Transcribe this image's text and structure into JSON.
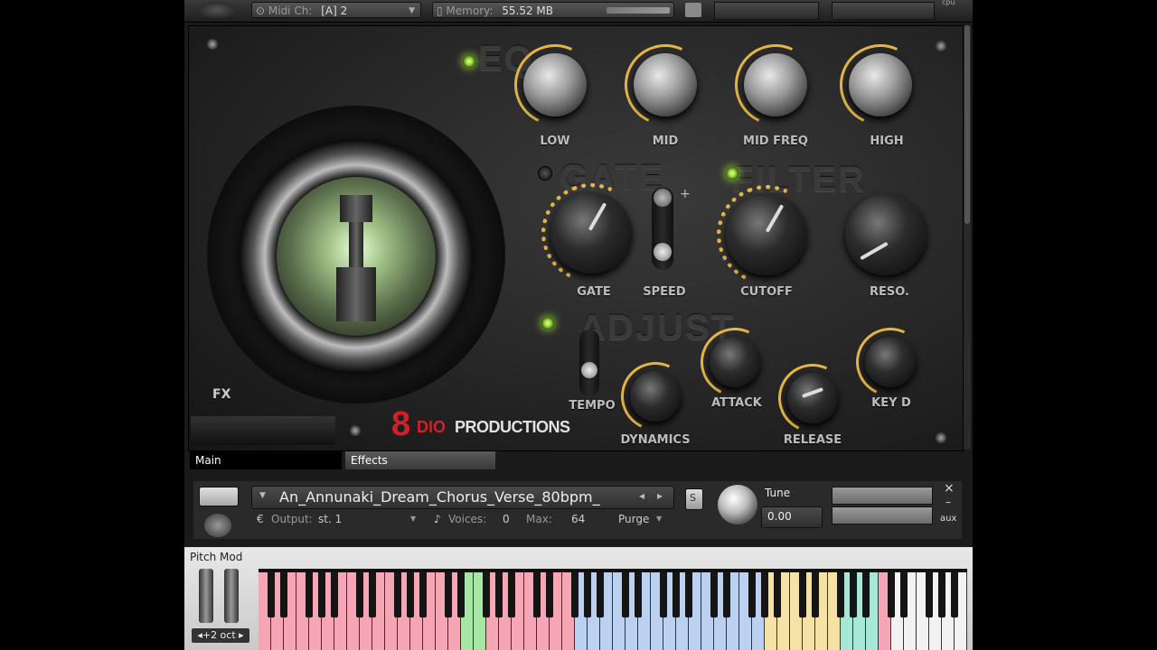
{
  "topbar": {
    "midi_label": "Midi Ch:",
    "midi_value": "[A]  2",
    "memory_label": "Memory:",
    "memory_value": "55.52 MB",
    "cpu_label": "cpu"
  },
  "panel": {
    "section_eq": "EQ",
    "section_gate": "GATE",
    "section_filter": "FILTER",
    "section_adjust": "ADJUST",
    "fx_label": "FX",
    "brand_mark": "8",
    "brand_dio": "DIO",
    "brand_productions": "PRODUCTIONS",
    "knobs": {
      "low": "LOW",
      "mid": "MID",
      "mid_freq": "MID FREQ",
      "high": "HIGH",
      "gate": "GATE",
      "speed": "SPEED",
      "cutoff": "CUTOFF",
      "reso": "RESO.",
      "tempo": "TEMPO",
      "dynamics": "DYNAMICS",
      "attack": "ATTACK",
      "release": "RELEASE",
      "key": "KEY  D"
    },
    "speed_plus": "+"
  },
  "tabs": {
    "main": "Main",
    "effects": "Effects"
  },
  "instrument": {
    "name": "An_Annunaki_Dream_Chorus_Verse_80bpm_",
    "output_label": "Output:",
    "output_value": "st. 1",
    "voices_label": "Voices:",
    "voices_value": "0",
    "max_label": "Max:",
    "max_value": "64",
    "purge_label": "Purge",
    "solo_label": "S",
    "tune_label": "Tune",
    "tune_value": "0.00",
    "aux_label": "aux",
    "close_label": "×",
    "minus_label": "–"
  },
  "keyboard": {
    "pitch_mod_label": "Pitch Mod",
    "octave_label": "◂+2 oct ▸",
    "colors": {
      "pink": "#f4a6b4",
      "green": "#a6e6a6",
      "blue": "#bcd1ef",
      "yellow": "#f5e2a6",
      "teal": "#a6e8d6",
      "white": "#f2f2f2",
      "black": "#151515"
    }
  },
  "colors": {
    "knob_ring": "#e2b544",
    "led_on": "#8fd22a",
    "brand_red": "#d41f2a"
  }
}
